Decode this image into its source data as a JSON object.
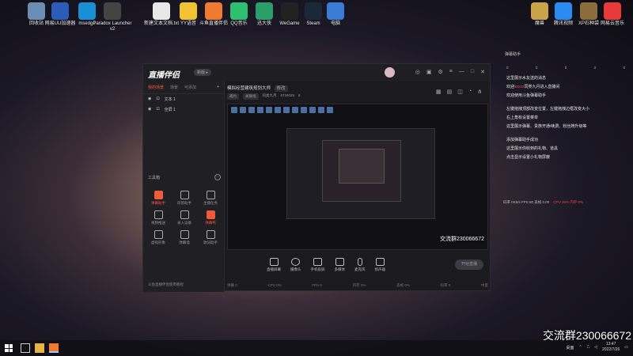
{
  "desktop": {
    "icons_left": [
      {
        "label": "回收站",
        "color": "#6c8db3"
      },
      {
        "label": "网易UU加速器",
        "color": "#2b5db8"
      },
      {
        "label": "msedge",
        "color": "#1a8fd6"
      },
      {
        "label": "Paradox Launcher v2",
        "color": "#444"
      },
      {
        "label": "新建文本文档.txt",
        "color": "#e8e8e8"
      },
      {
        "label": "YY语音",
        "color": "#f2c230"
      },
      {
        "label": "斗鱼直播伴侣",
        "color": "#f07a30"
      },
      {
        "label": "QQ音乐",
        "color": "#2fbf71"
      },
      {
        "label": "迅大侠",
        "color": "#2a9d6a"
      },
      {
        "label": "WeGame",
        "color": "#222"
      },
      {
        "label": "Steam",
        "color": "#1b2838"
      },
      {
        "label": "电脑",
        "color": "#3a7bd5"
      }
    ],
    "icons_right": [
      {
        "label": "魔兽",
        "color": "#caa24a"
      },
      {
        "label": "腾讯视频",
        "color": "#2a8cf0"
      },
      {
        "label": "XP石种袋",
        "color": "#8a6d3b"
      },
      {
        "label": "网易云音乐",
        "color": "#e83a3a"
      }
    ],
    "overlay_big_text": "交流群230066672"
  },
  "app": {
    "brand": "直播伴侣",
    "version_badge": "新版 ▸",
    "left_tabs": [
      "我的场景",
      "场景",
      "可添加"
    ],
    "add_icon": "+",
    "sources": [
      {
        "name": "文本 1"
      },
      {
        "name": "全屏 1"
      }
    ],
    "tools_title": "工具箱",
    "tools_more": "···",
    "tools": [
      {
        "label": "弹幕助手",
        "hot": true
      },
      {
        "label": "房管助手",
        "hot": false
      },
      {
        "label": "主播任务",
        "hot": false
      },
      {
        "label": "视频推送",
        "hot": false
      },
      {
        "label": "录入设备",
        "hot": false
      },
      {
        "label": "弹幕鸭",
        "hot": true
      },
      {
        "label": "虚拟形象",
        "hot": false
      },
      {
        "label": "弹幕墙",
        "hot": false
      },
      {
        "label": "歌词助手",
        "hot": false
      }
    ],
    "left_footer": "斗鱼直播伴侣使用教程",
    "room_title": "模拟经营建筑规划大师",
    "room_tag": "修改",
    "room_meta": [
      "邀约",
      "关联线",
      "同类九月",
      "6734025",
      "8"
    ],
    "preview_overlay_text": "交流群230066672",
    "controls": [
      "直播屏幕",
      "摄像头",
      "手机投屏",
      "多媒体",
      "麦克风",
      "扬声器"
    ],
    "go_live": "开始直播",
    "status": [
      "弹幕 0",
      "CPU 0%",
      "FPS 0",
      "内存 0%",
      "丢帧 0%",
      "码率 0",
      "中度"
    ]
  },
  "danmaku": {
    "header": "弹幕助手",
    "stats": [
      "0",
      "0",
      "0",
      "0",
      "0"
    ],
    "messages": [
      {
        "text": "这里展示水友送的消息"
      },
      {
        "prefix": "欢迎",
        "highlight": "xxxxx",
        "suffix": "同类九月进入直播间"
      },
      {
        "text": "欢迎使用斗鱼弹幕助手"
      },
      {
        "text": "左键拖拽顶部改变位置，左键拖拽边框改变大小"
      },
      {
        "text": "右上角有设置菜单"
      },
      {
        "text": "这里展示弹幕、贵族开通/续费、粉丝牌升级等"
      },
      {
        "text": "添加弹幕助手成功"
      },
      {
        "text": "这里展示你收到的礼物、道具"
      },
      {
        "text": "点击显示设置小礼物屏蔽"
      }
    ],
    "footer_left": "码率 0Kb/s  FPS 60  丢帧 0.00",
    "footer_right": "CPU 25%  内存 0%"
  },
  "taskbar": {
    "time": "13:47",
    "date": "2022/7/26",
    "tray_label": "桌面"
  }
}
